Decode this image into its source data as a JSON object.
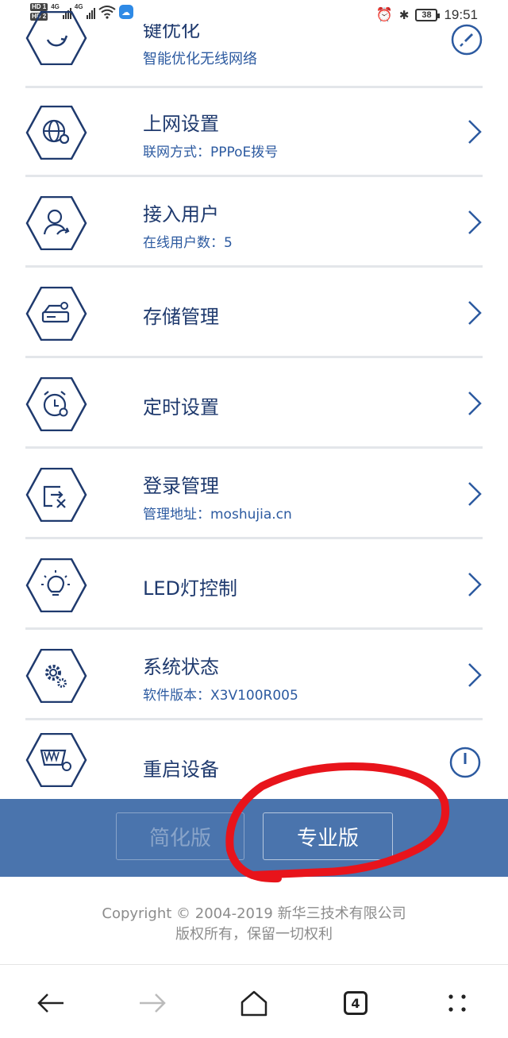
{
  "status_bar": {
    "sim1_badge": "HD 1",
    "sim2_badge": "HD 2",
    "net1": "4G",
    "net2": "4G",
    "battery": "38",
    "time": "19:51",
    "icons": [
      "alarm-icon",
      "bluetooth-icon",
      "wifi-icon",
      "weather-icon"
    ]
  },
  "top_partial": {
    "title_fragment": "键优化",
    "subtitle": "智能优化无线网络",
    "action_icon": "rocket-icon"
  },
  "menu": [
    {
      "title": "上网设置",
      "subtitle": "联网方式：PPPoE拨号",
      "icon": "globe-gear-icon"
    },
    {
      "title": "接入用户",
      "subtitle": "在线用户数：5",
      "icon": "user-icon"
    },
    {
      "title": "存储管理",
      "subtitle": "",
      "icon": "storage-icon"
    },
    {
      "title": "定时设置",
      "subtitle": "",
      "icon": "alarm-clock-icon"
    },
    {
      "title": "登录管理",
      "subtitle": "管理地址：moshujia.cn",
      "icon": "login-icon"
    },
    {
      "title": "LED灯控制",
      "subtitle": "",
      "icon": "bulb-icon"
    },
    {
      "title": "系统状态",
      "subtitle": "软件版本：X3V100R005",
      "icon": "gear-icon"
    }
  ],
  "restart": {
    "title": "重启设备",
    "icon": "restart-device-icon",
    "action_icon": "power-icon"
  },
  "mode_bar": {
    "simple_label": "简化版",
    "pro_label": "专业版"
  },
  "footer": {
    "copyright": "Copyright © 2004-2019 新华三技术有限公司",
    "rights": "版权所有，保留一切权利"
  },
  "browser_nav": {
    "tab_count": "4"
  },
  "colors": {
    "accent": "#1f3a6e",
    "bar_blue": "#4a74ad",
    "annotation_red": "#e8141b"
  }
}
